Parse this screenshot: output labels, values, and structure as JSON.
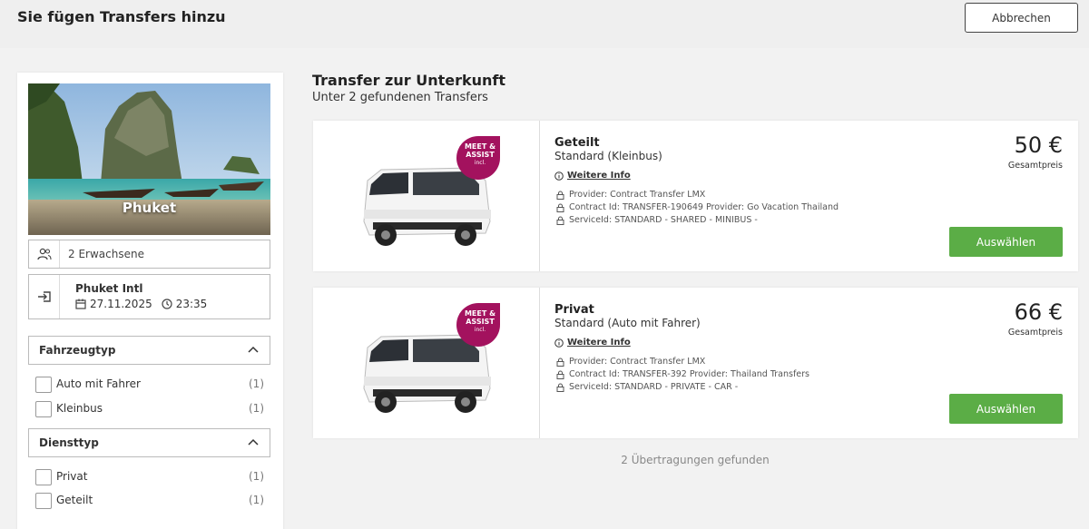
{
  "header": {
    "title": "Sie fügen Transfers hinzu",
    "cancel_label": "Abbrechen"
  },
  "sidebar": {
    "destination": "Phuket",
    "passengers": "2 Erwachsene",
    "airport": {
      "name": "Phuket Intl",
      "date": "27.11.2025",
      "time": "23:35"
    },
    "filters": [
      {
        "title": "Fahrzeugtyp",
        "options": [
          {
            "label": "Auto mit Fahrer",
            "count": "(1)"
          },
          {
            "label": "Kleinbus",
            "count": "(1)"
          }
        ]
      },
      {
        "title": "Diensttyp",
        "options": [
          {
            "label": "Privat",
            "count": "(1)"
          },
          {
            "label": "Geteilt",
            "count": "(1)"
          }
        ]
      }
    ]
  },
  "main": {
    "title": "Transfer zur Unterkunft",
    "subtitle": "Unter 2 gefundenen Transfers",
    "footer": "2 Übertragungen gefunden"
  },
  "results": [
    {
      "name": "Geteilt",
      "vehicle": "Standard (Kleinbus)",
      "more_info": "Weitere Info",
      "details": [
        "Provider: Contract Transfer LMX",
        "Contract Id: TRANSFER-190649 Provider: Go Vacation Thailand",
        "ServiceId: STANDARD - SHARED - MINIBUS -"
      ],
      "price": "50 €",
      "price_label": "Gesamtpreis",
      "select_label": "Auswählen",
      "badge": [
        "MEET &",
        "ASSIST",
        "incl."
      ]
    },
    {
      "name": "Privat",
      "vehicle": "Standard (Auto mit Fahrer)",
      "more_info": "Weitere Info",
      "details": [
        "Provider: Contract Transfer LMX",
        "Contract Id: TRANSFER-392 Provider: Thailand Transfers",
        "ServiceId: STANDARD - PRIVATE - CAR -"
      ],
      "price": "66 €",
      "price_label": "Gesamtpreis",
      "select_label": "Auswählen",
      "badge": [
        "MEET &",
        "ASSIST",
        "incl."
      ]
    }
  ],
  "colors": {
    "accent_green": "#5bad46",
    "badge": "#a3125e"
  }
}
